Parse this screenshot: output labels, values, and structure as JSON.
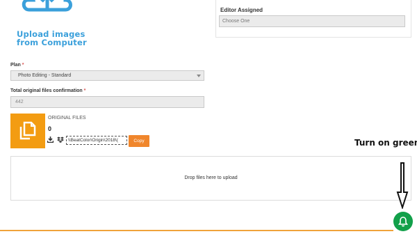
{
  "upload": {
    "line1": "Upload images",
    "line2": "from Computer"
  },
  "editor": {
    "label": "Editor Assigned",
    "placeholder": "Choose One"
  },
  "plan": {
    "label": "Plan",
    "required_mark": "*",
    "selected": "Photo Editing - Standard"
  },
  "total": {
    "label": "Total original files confirmation",
    "required_mark": "*",
    "value": "442"
  },
  "original_files": {
    "label": "ORIGINAL FILES",
    "count": "0",
    "path": "\\\\BeatColor\\Origin\\2018\\(",
    "copy_label": "Copy"
  },
  "dropzone": {
    "text": "Drop files here to upload"
  },
  "annotation": {
    "text": "Turn on green"
  },
  "icons": {
    "cloud": "cloud-upload-icon",
    "copy": "copy-files-icon",
    "download": "download-icon",
    "dropbox": "dropbox-icon",
    "bell": "bell-icon",
    "arrow": "arrow-down-icon"
  },
  "colors": {
    "accent_orange": "#f39c12",
    "upload_blue": "#3ba0db",
    "bell_green": "#12a04a"
  }
}
